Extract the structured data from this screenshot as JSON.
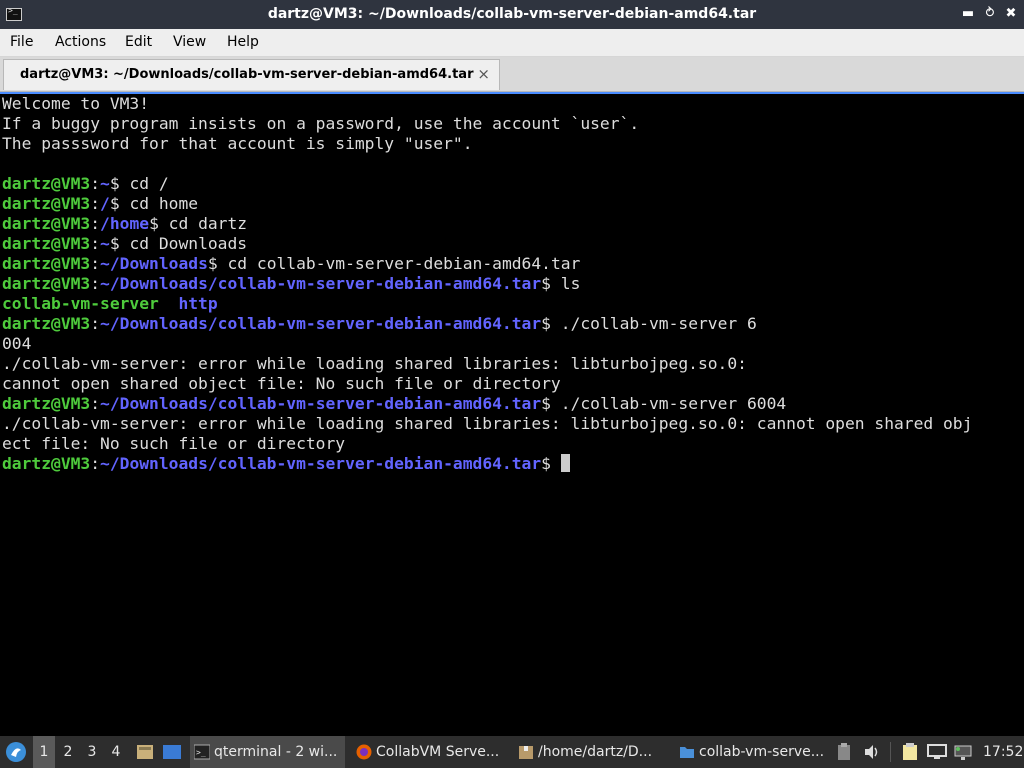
{
  "window": {
    "title": "dartz@VM3: ~/Downloads/collab-vm-server-debian-amd64.tar",
    "minimize_icon": "minimize-icon",
    "maximize_icon": "maximize-icon",
    "close_icon": "close-icon"
  },
  "menubar": {
    "items": [
      "File",
      "Actions",
      "Edit",
      "View",
      "Help"
    ]
  },
  "tab": {
    "label": "dartz@VM3: ~/Downloads/collab-vm-server-debian-amd64.tar",
    "close": "×"
  },
  "terminal": {
    "lines": [
      [
        {
          "t": "Welcome to VM3!",
          "c": ""
        }
      ],
      [
        {
          "t": "If a buggy program insists on a password, use the account `user`.",
          "c": ""
        }
      ],
      [
        {
          "t": "The passsword for that account is simply \"user\".",
          "c": ""
        }
      ],
      [
        {
          "t": "",
          "c": ""
        }
      ],
      [
        {
          "t": "dartz@VM3",
          "c": "u"
        },
        {
          "t": ":",
          "c": ""
        },
        {
          "t": "~",
          "c": "p"
        },
        {
          "t": "$ cd /",
          "c": ""
        }
      ],
      [
        {
          "t": "dartz@VM3",
          "c": "u"
        },
        {
          "t": ":",
          "c": ""
        },
        {
          "t": "/",
          "c": "p"
        },
        {
          "t": "$ cd home",
          "c": ""
        }
      ],
      [
        {
          "t": "dartz@VM3",
          "c": "u"
        },
        {
          "t": ":",
          "c": ""
        },
        {
          "t": "/home",
          "c": "p"
        },
        {
          "t": "$ cd dartz",
          "c": ""
        }
      ],
      [
        {
          "t": "dartz@VM3",
          "c": "u"
        },
        {
          "t": ":",
          "c": ""
        },
        {
          "t": "~",
          "c": "p"
        },
        {
          "t": "$ cd Downloads",
          "c": ""
        }
      ],
      [
        {
          "t": "dartz@VM3",
          "c": "u"
        },
        {
          "t": ":",
          "c": ""
        },
        {
          "t": "~/Downloads",
          "c": "p"
        },
        {
          "t": "$ cd collab-vm-server-debian-amd64.tar",
          "c": ""
        }
      ],
      [
        {
          "t": "dartz@VM3",
          "c": "u"
        },
        {
          "t": ":",
          "c": ""
        },
        {
          "t": "~/Downloads/collab-vm-server-debian-amd64.tar",
          "c": "p"
        },
        {
          "t": "$ ls",
          "c": ""
        }
      ],
      [
        {
          "t": "collab-vm-server",
          "c": "u"
        },
        {
          "t": "  ",
          "c": ""
        },
        {
          "t": "http",
          "c": "d"
        }
      ],
      [
        {
          "t": "dartz@VM3",
          "c": "u"
        },
        {
          "t": ":",
          "c": ""
        },
        {
          "t": "~/Downloads/collab-vm-server-debian-amd64.tar",
          "c": "p"
        },
        {
          "t": "$ ./collab-vm-server 6",
          "c": ""
        }
      ],
      [
        {
          "t": "004",
          "c": ""
        }
      ],
      [
        {
          "t": "./collab-vm-server: error while loading shared libraries: libturbojpeg.so.0:",
          "c": ""
        }
      ],
      [
        {
          "t": "cannot open shared object file: No such file or directory",
          "c": ""
        }
      ],
      [
        {
          "t": "dartz@VM3",
          "c": "u"
        },
        {
          "t": ":",
          "c": ""
        },
        {
          "t": "~/Downloads/collab-vm-server-debian-amd64.tar",
          "c": "p"
        },
        {
          "t": "$ ./collab-vm-server 6004",
          "c": ""
        }
      ],
      [
        {
          "t": "./collab-vm-server: error while loading shared libraries: libturbojpeg.so.0: cannot open shared obj",
          "c": ""
        }
      ],
      [
        {
          "t": "ect file: No such file or directory",
          "c": ""
        }
      ],
      [
        {
          "t": "dartz@VM3",
          "c": "u"
        },
        {
          "t": ":",
          "c": ""
        },
        {
          "t": "~/Downloads/collab-vm-server-debian-amd64.tar",
          "c": "p"
        },
        {
          "t": "$ ",
          "c": ""
        },
        {
          "t": "",
          "c": "cursor"
        }
      ]
    ]
  },
  "taskbar": {
    "desktops": [
      "1",
      "2",
      "3",
      "4"
    ],
    "tasks": [
      {
        "label": "qterminal - 2 wi...",
        "icon": "terminal-icon"
      },
      {
        "label": "CollabVM Serve...",
        "icon": "firefox-icon"
      },
      {
        "label": "/home/dartz/D...",
        "icon": "archive-icon"
      },
      {
        "label": "collab-vm-serve...",
        "icon": "folder-icon"
      }
    ],
    "clock": "17:52"
  },
  "colors": {
    "titlebar": "#2f343f",
    "prompt_user": "#4ecb3c",
    "prompt_path": "#6264ff",
    "taskbar": "#2d2d2d"
  }
}
